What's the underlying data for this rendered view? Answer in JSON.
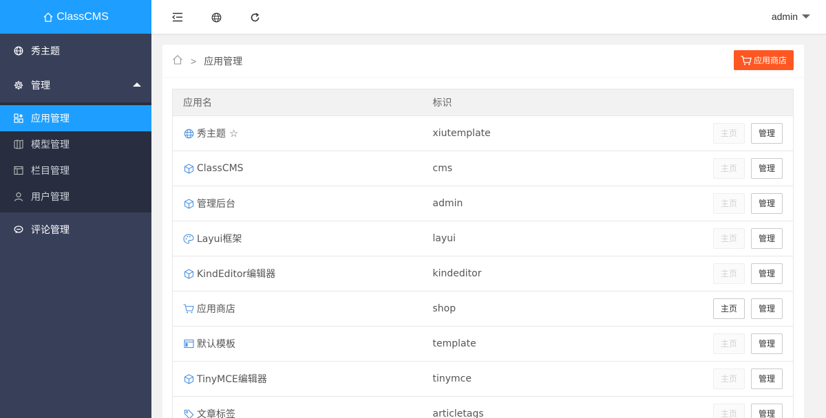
{
  "brand": {
    "name": "ClassCMS"
  },
  "sidebar": {
    "items": [
      {
        "label": "秀主题",
        "icon": "globe-icon"
      },
      {
        "label": "管理",
        "icon": "gear-icon",
        "expanded": true
      },
      {
        "label": "评论管理",
        "icon": "comment-icon"
      }
    ],
    "subitems": [
      {
        "label": "应用管理",
        "icon": "apps-icon",
        "active": true
      },
      {
        "label": "模型管理",
        "icon": "model-icon"
      },
      {
        "label": "栏目管理",
        "icon": "column-icon"
      },
      {
        "label": "用户管理",
        "icon": "user-icon"
      }
    ]
  },
  "header": {
    "user": "admin"
  },
  "breadcrumb": {
    "current": "应用管理",
    "sep": ">"
  },
  "shop_button": {
    "label": "应用商店"
  },
  "table": {
    "columns": [
      "应用名",
      "标识",
      ""
    ],
    "home_label": "主页",
    "manage_label": "管理",
    "rows": [
      {
        "name": "秀主题",
        "id": "xiutemplate",
        "icon": "globe-icon",
        "star": true,
        "home_enabled": false
      },
      {
        "name": "ClassCMS",
        "id": "cms",
        "icon": "cube-icon",
        "home_enabled": false
      },
      {
        "name": "管理后台",
        "id": "admin",
        "icon": "cube-icon",
        "home_enabled": false
      },
      {
        "name": "Layui框架",
        "id": "layui",
        "icon": "palette-icon",
        "home_enabled": false
      },
      {
        "name": "KindEditor编辑器",
        "id": "kindeditor",
        "icon": "cube-icon",
        "home_enabled": false
      },
      {
        "name": "应用商店",
        "id": "shop",
        "icon": "cart-icon",
        "home_enabled": true
      },
      {
        "name": "默认模板",
        "id": "template",
        "icon": "window-icon",
        "home_enabled": false
      },
      {
        "name": "TinyMCE编辑器",
        "id": "tinymce",
        "icon": "cube-icon",
        "home_enabled": false
      },
      {
        "name": "文章标签",
        "id": "articletags",
        "icon": "tag-icon",
        "home_enabled": false
      }
    ]
  },
  "colors": {
    "accent": "#1e9fff",
    "sidebar": "#384059",
    "shop": "#ff5722",
    "icon_blue": "#4a90e2"
  }
}
